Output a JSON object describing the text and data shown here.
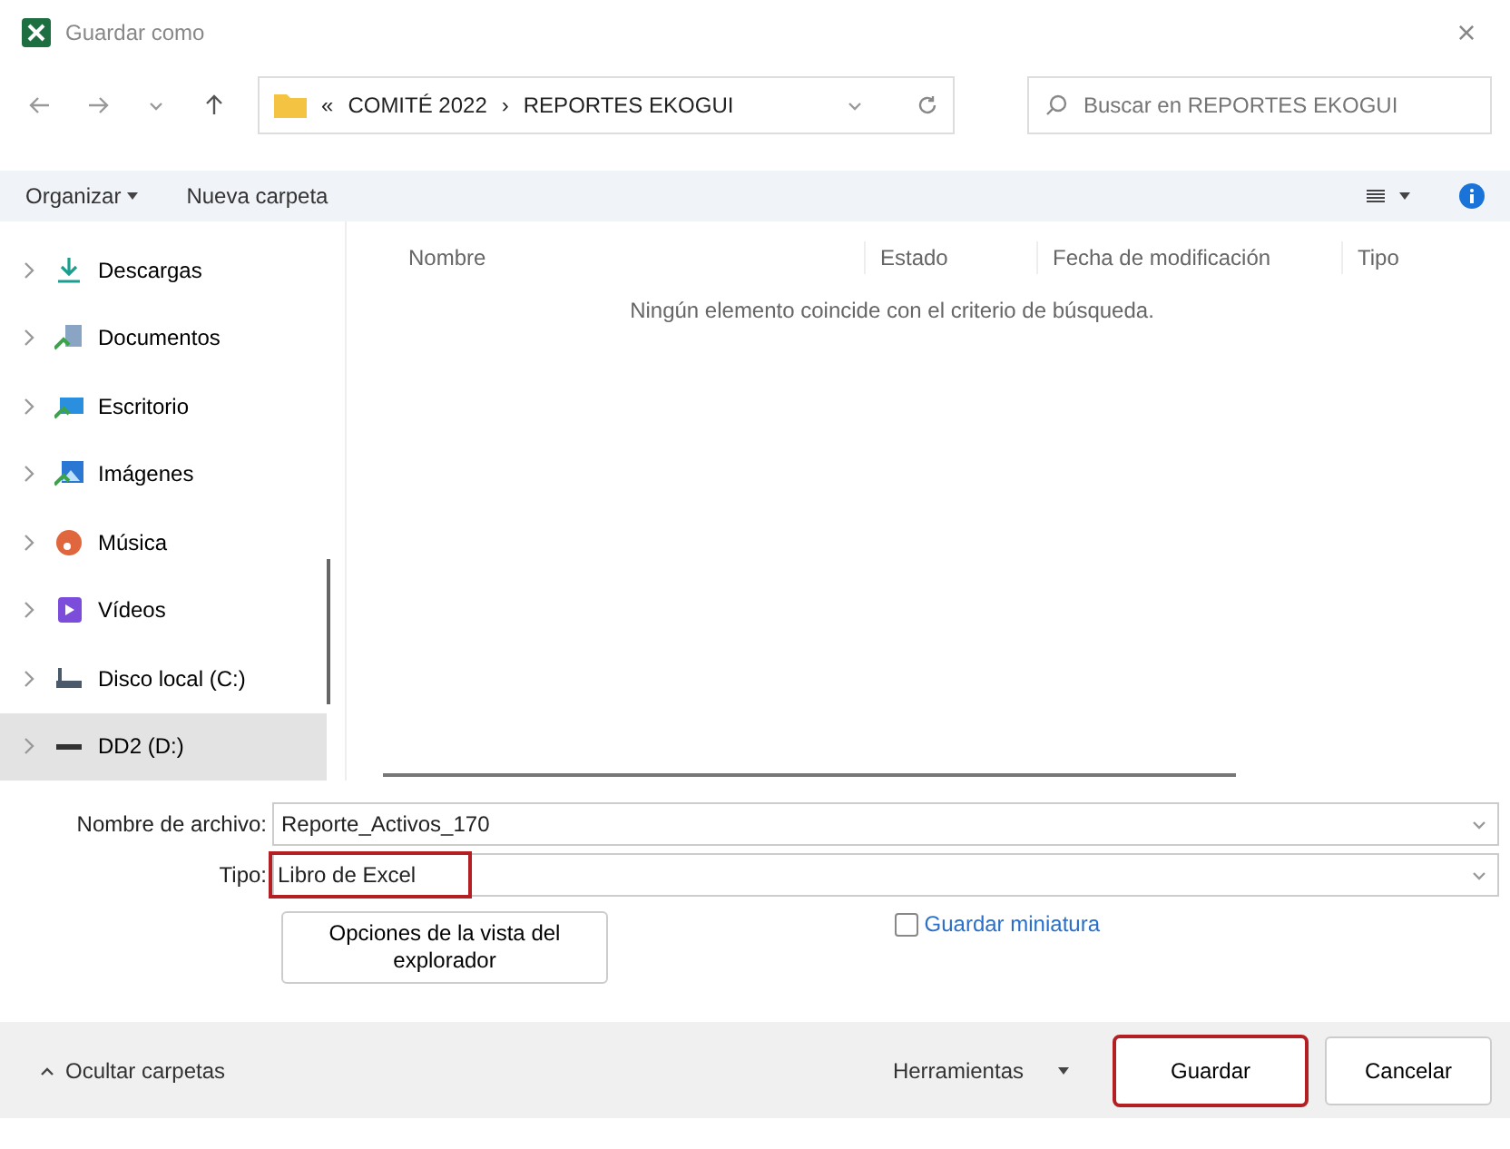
{
  "window": {
    "title": "Guardar como",
    "close": "×"
  },
  "address": {
    "overflow": "«",
    "path": [
      {
        "label": "COMITÉ 2022"
      },
      {
        "label": "REPORTES EKOGUI"
      }
    ],
    "separator": "›"
  },
  "search": {
    "placeholder": "Buscar en REPORTES EKOGUI"
  },
  "toolbar": {
    "organize": "Organizar",
    "new_folder": "Nueva carpeta"
  },
  "sidebar": {
    "items": [
      {
        "label": "Descargas",
        "selected": false
      },
      {
        "label": "Documentos",
        "selected": false
      },
      {
        "label": "Escritorio",
        "selected": false
      },
      {
        "label": "Imágenes",
        "selected": false
      },
      {
        "label": "Música",
        "selected": false
      },
      {
        "label": "Vídeos",
        "selected": false
      },
      {
        "label": "Disco local (C:)",
        "selected": false
      },
      {
        "label": "DD2 (D:)",
        "selected": true
      }
    ]
  },
  "table": {
    "columns": [
      "Nombre",
      "Estado",
      "Fecha de modificación",
      "Tipo"
    ],
    "empty_message": "Ningún elemento coincide con el criterio de búsqueda."
  },
  "fields": [
    {
      "label": "Nombre de archivo:",
      "value": "Reporte_Activos_170",
      "highlighted": false
    },
    {
      "label": "Tipo:",
      "value": "Libro de Excel",
      "highlighted": true
    }
  ],
  "options_button": "Opciones de la vista del explorador",
  "thumbnail": {
    "label": "Guardar miniatura",
    "checked": false
  },
  "footer": {
    "hide_folders": "Ocultar carpetas",
    "tools": "Herramientas",
    "buttons": [
      {
        "label": "Guardar",
        "highlighted": true
      },
      {
        "label": "Cancelar",
        "highlighted": false
      }
    ]
  }
}
